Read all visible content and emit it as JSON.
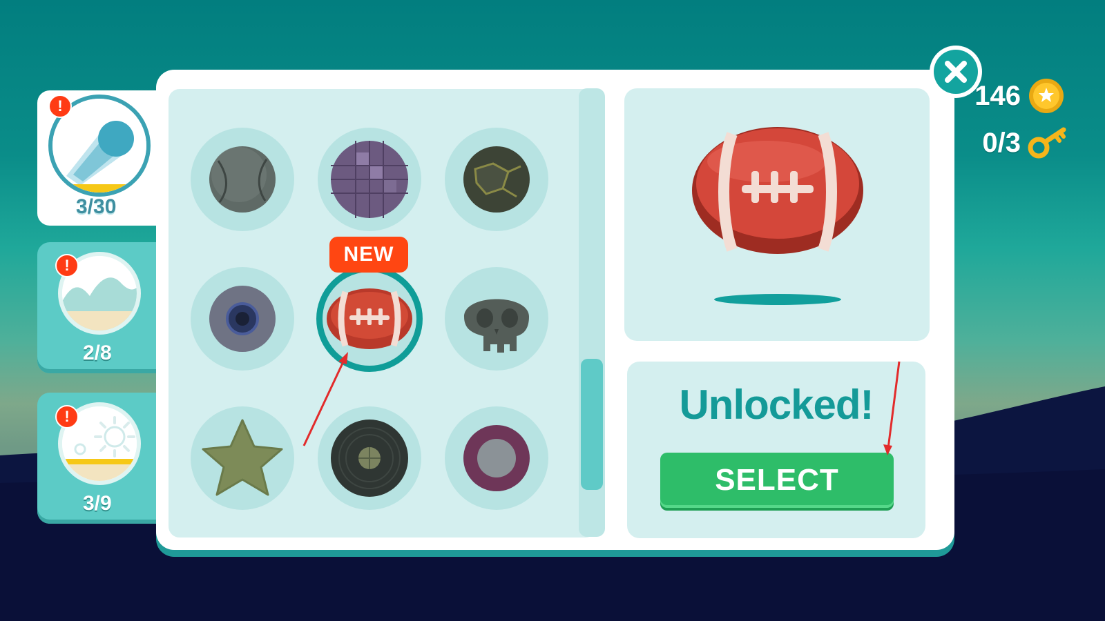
{
  "categories": [
    {
      "id": "trails",
      "count": "3/30",
      "alert": "!",
      "icon": "comet-icon",
      "active": true
    },
    {
      "id": "terrain",
      "count": "2/8",
      "alert": "!",
      "icon": "hills-icon",
      "active": false
    },
    {
      "id": "weather",
      "count": "3/9",
      "alert": "!",
      "icon": "sun-icon",
      "active": false
    }
  ],
  "grid": {
    "items": [
      {
        "name": "stone-ball",
        "icon": "stone-ball-icon"
      },
      {
        "name": "disco-ball",
        "icon": "disco-ball-icon"
      },
      {
        "name": "lava-rock-ball",
        "icon": "lava-rock-ball-icon"
      },
      {
        "name": "eyeball",
        "icon": "eyeball-icon"
      },
      {
        "name": "football",
        "icon": "football-icon",
        "selected": true,
        "badge": "NEW"
      },
      {
        "name": "skull",
        "icon": "skull-icon"
      },
      {
        "name": "star",
        "icon": "star-icon"
      },
      {
        "name": "vinyl-record",
        "icon": "vinyl-record-icon"
      },
      {
        "name": "donut-ring",
        "icon": "ring-icon"
      }
    ],
    "new_badge": "NEW"
  },
  "preview": {
    "item": "football",
    "icon": "football-icon"
  },
  "status": {
    "title": "Unlocked!",
    "button_label": "SELECT"
  },
  "currency": {
    "coins": "146",
    "coin_icon": "coin-icon",
    "keys": "0/3",
    "key_icon": "key-icon"
  },
  "colors": {
    "accent": "#149a98",
    "select_button": "#2ebd69",
    "badge": "#ff4612",
    "alert": "#ff3b14"
  }
}
